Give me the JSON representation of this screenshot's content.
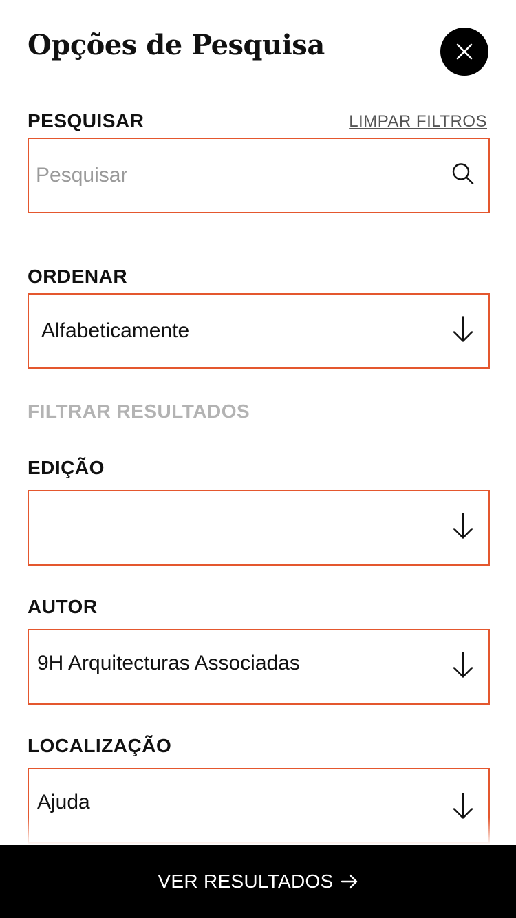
{
  "header": {
    "title": "Opções de Pesquisa",
    "close_icon": "close-icon"
  },
  "search": {
    "label": "PESQUISAR",
    "clear_filters": "LIMPAR FILTROS",
    "placeholder": "Pesquisar",
    "value": "",
    "icon": "search-icon"
  },
  "sort": {
    "label": "ORDENAR",
    "selected": "Alfabeticamente",
    "icon": "arrow-down-icon"
  },
  "filters": {
    "heading": "FILTRAR RESULTADOS",
    "edition": {
      "label": "EDIÇÃO",
      "selected": ""
    },
    "author": {
      "label": "AUTOR",
      "selected": "9H Arquitecturas Associadas"
    },
    "location": {
      "label": "LOCALIZAÇÃO",
      "selected": "Ajuda"
    }
  },
  "footer": {
    "cta_label": "VER RESULTADOS",
    "cta_icon": "arrow-right-icon"
  },
  "colors": {
    "accent_border": "#e4572e",
    "muted_text": "#b3b3b3",
    "cta_background": "#000000"
  }
}
